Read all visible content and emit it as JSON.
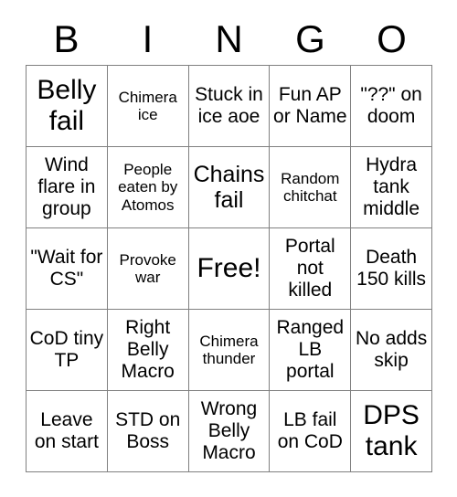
{
  "card": {
    "header_letters": [
      "B",
      "I",
      "N",
      "G",
      "O"
    ],
    "rows": [
      [
        {
          "text": "Belly fail",
          "size": "fs-xl"
        },
        {
          "text": "Chimera ice",
          "size": "fs-sm"
        },
        {
          "text": "Stuck in ice aoe",
          "size": "fs-md"
        },
        {
          "text": "Fun AP or Name",
          "size": "fs-md"
        },
        {
          "text": "\"??\" on doom",
          "size": "fs-md"
        }
      ],
      [
        {
          "text": "Wind flare in group",
          "size": "fs-md"
        },
        {
          "text": "People eaten by Atomos",
          "size": "fs-sm"
        },
        {
          "text": "Chains fail",
          "size": "fs-lg"
        },
        {
          "text": "Random chitchat",
          "size": "fs-sm"
        },
        {
          "text": "Hydra tank middle",
          "size": "fs-md"
        }
      ],
      [
        {
          "text": "\"Wait for CS\"",
          "size": "fs-md"
        },
        {
          "text": "Provoke war",
          "size": "fs-sm"
        },
        {
          "text": "Free!",
          "size": "fs-xl"
        },
        {
          "text": "Portal not killed",
          "size": "fs-md"
        },
        {
          "text": "Death 150 kills",
          "size": "fs-md"
        }
      ],
      [
        {
          "text": "CoD tiny TP",
          "size": "fs-md"
        },
        {
          "text": "Right Belly Macro",
          "size": "fs-md"
        },
        {
          "text": "Chimera thunder",
          "size": "fs-sm"
        },
        {
          "text": "Ranged LB portal",
          "size": "fs-md"
        },
        {
          "text": "No adds skip",
          "size": "fs-md"
        }
      ],
      [
        {
          "text": "Leave on start",
          "size": "fs-md"
        },
        {
          "text": "STD on Boss",
          "size": "fs-md"
        },
        {
          "text": "Wrong Belly Macro",
          "size": "fs-md"
        },
        {
          "text": "LB fail on CoD",
          "size": "fs-md"
        },
        {
          "text": "DPS tank",
          "size": "fs-xl"
        }
      ]
    ],
    "colors": {
      "background": "#ffffff",
      "text": "#000000",
      "grid_line": "#808080"
    }
  }
}
